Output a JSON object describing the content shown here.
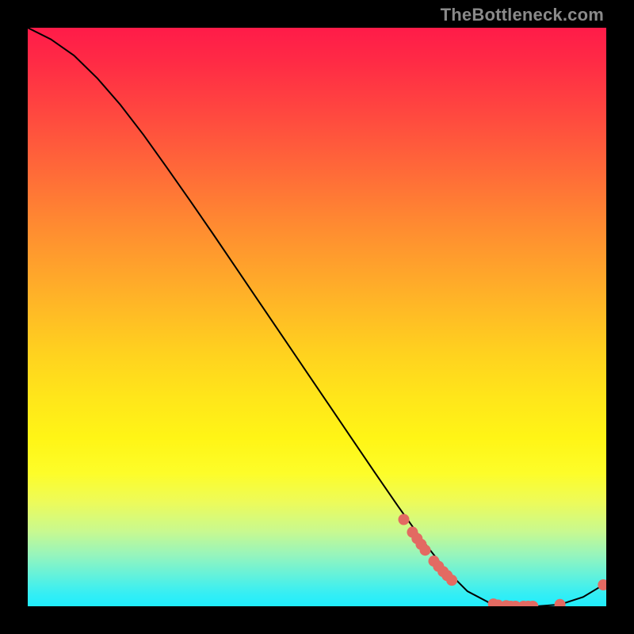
{
  "watermark": "TheBottleneck.com",
  "colors": {
    "marker": "#e36a62",
    "line": "#000000"
  },
  "chart_data": {
    "type": "line",
    "title": "",
    "xlabel": "",
    "ylabel": "",
    "xlim": [
      0,
      100
    ],
    "ylim": [
      0,
      100
    ],
    "grid": false,
    "series": [
      {
        "name": "curve",
        "x": [
          0,
          4,
          8,
          12,
          16,
          20,
          24,
          28,
          32,
          36,
          40,
          44,
          48,
          52,
          56,
          60,
          64,
          68,
          72,
          76,
          80,
          84,
          88,
          92,
          96,
          100
        ],
        "y": [
          100,
          98.0,
          95.2,
          91.3,
          86.7,
          81.5,
          75.9,
          70.2,
          64.4,
          58.5,
          52.6,
          46.7,
          40.8,
          34.9,
          29.0,
          23.1,
          17.3,
          11.7,
          6.6,
          2.6,
          0.5,
          0.0,
          0.0,
          0.3,
          1.6,
          4.0
        ]
      }
    ],
    "markers": {
      "name": "highlighted-points",
      "x": [
        65,
        66.5,
        67.3,
        68,
        68.7,
        70.2,
        71,
        71.8,
        72.5,
        73.3,
        80.5,
        81.3,
        82.7,
        83.5,
        84.3,
        85.7,
        86.5,
        87.3,
        92.0,
        99.5
      ],
      "y": [
        15.0,
        12.8,
        11.7,
        10.7,
        9.7,
        7.8,
        6.9,
        6.0,
        5.3,
        4.5,
        0.4,
        0.2,
        0.1,
        0.0,
        0.0,
        0.0,
        0.0,
        0.0,
        0.3,
        3.7
      ]
    }
  }
}
